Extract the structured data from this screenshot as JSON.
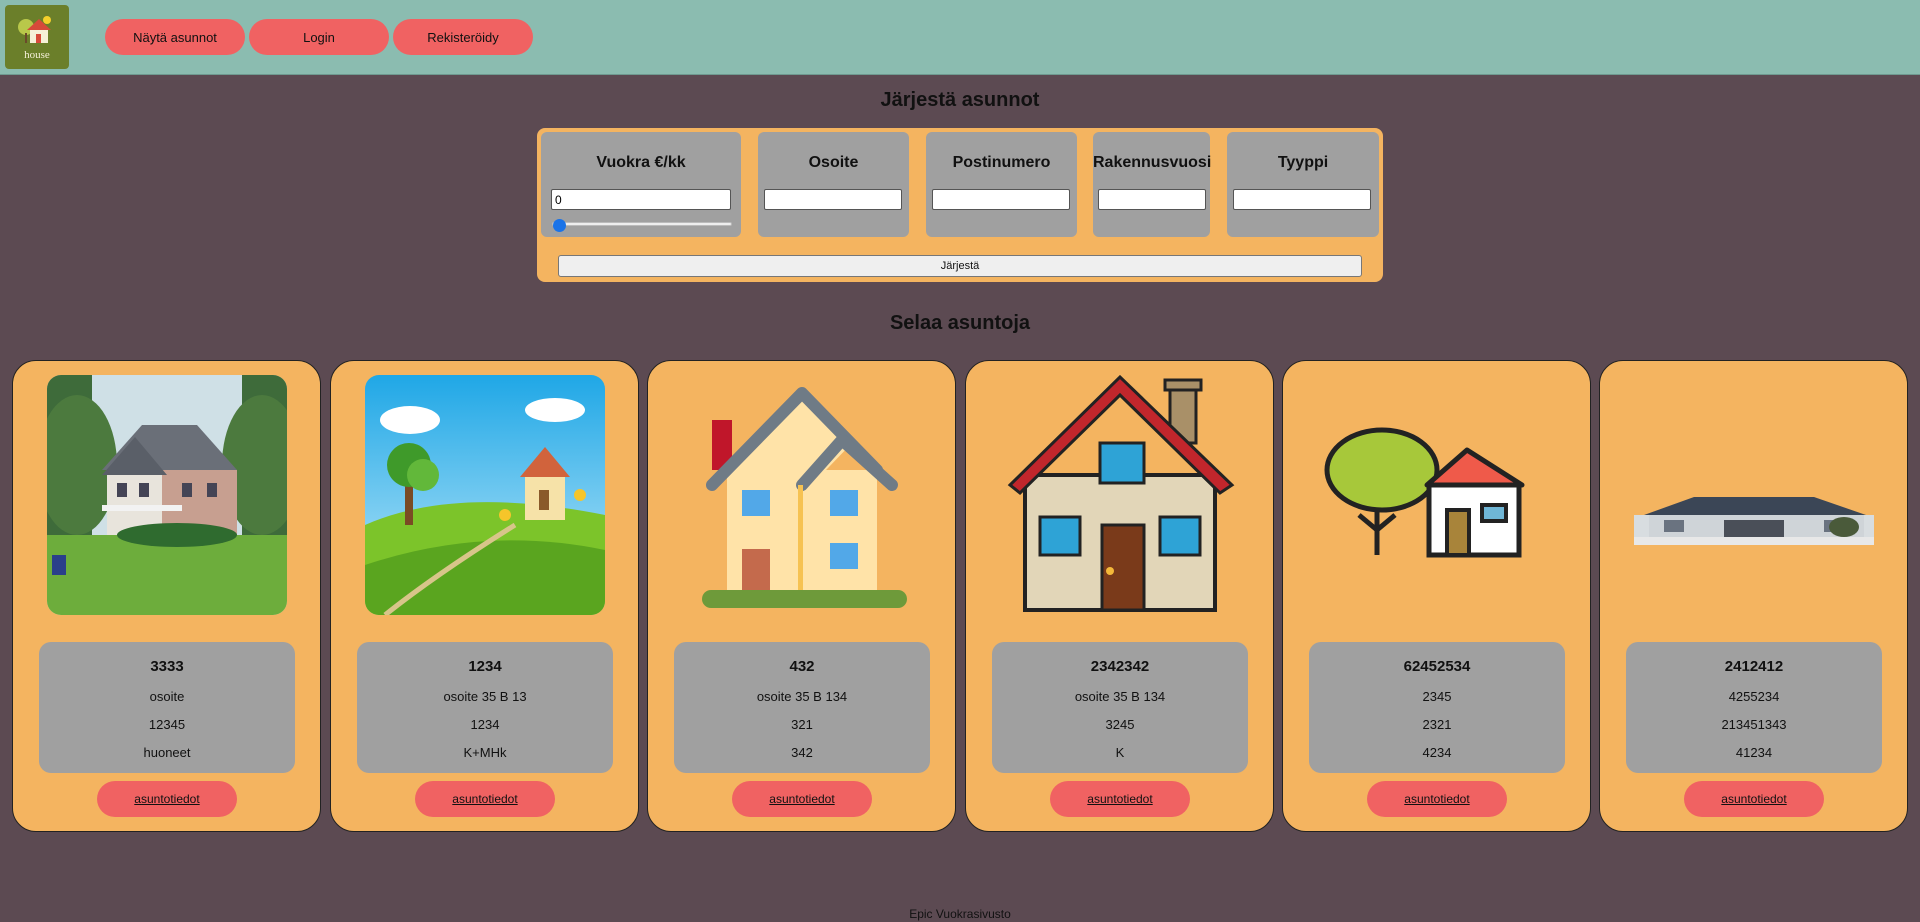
{
  "header": {
    "logo_text": "house",
    "nav": [
      {
        "label": "Näytä asunnot"
      },
      {
        "label": "Login"
      },
      {
        "label": "Rekisteröidy"
      }
    ]
  },
  "sort_section": {
    "title": "Järjestä asunnot",
    "filters": [
      {
        "label": "Vuokra €/kk",
        "value": "",
        "placeholder": ""
      },
      {
        "label": "Osoite",
        "value": "",
        "placeholder": ""
      },
      {
        "label": "Postinumero",
        "value": "",
        "placeholder": ""
      },
      {
        "label": "Rakennusvuosi",
        "value": "",
        "placeholder": ""
      },
      {
        "label": "Tyyppi",
        "value": "",
        "placeholder": ""
      }
    ],
    "rent_value": "0",
    "slider_fraction": 0,
    "sort_button": "Järjestä"
  },
  "listings": {
    "title": "Selaa asuntoja",
    "cards": [
      {
        "price": "3333",
        "address": "osoite",
        "postal": "12345",
        "type": "huoneet",
        "button": "asuntotiedot"
      },
      {
        "price": "1234",
        "address": "osoite 35 B 13",
        "postal": "1234",
        "type": "K+MHk",
        "button": "asuntotiedot"
      },
      {
        "price": "432",
        "address": "osoite 35 B 134",
        "postal": "321",
        "type": "342",
        "button": "asuntotiedot"
      },
      {
        "price": "2342342",
        "address": "osoite 35 B 134",
        "postal": "3245",
        "type": "K",
        "button": "asuntotiedot"
      },
      {
        "price": "62452534",
        "address": "2345",
        "postal": "2321",
        "type": "4234",
        "button": "asuntotiedot"
      },
      {
        "price": "2412412",
        "address": "4255234",
        "postal": "213451343",
        "type": "41234",
        "button": "asuntotiedot"
      }
    ]
  },
  "footer": {
    "text": "Epic Vuokrasivusto"
  }
}
